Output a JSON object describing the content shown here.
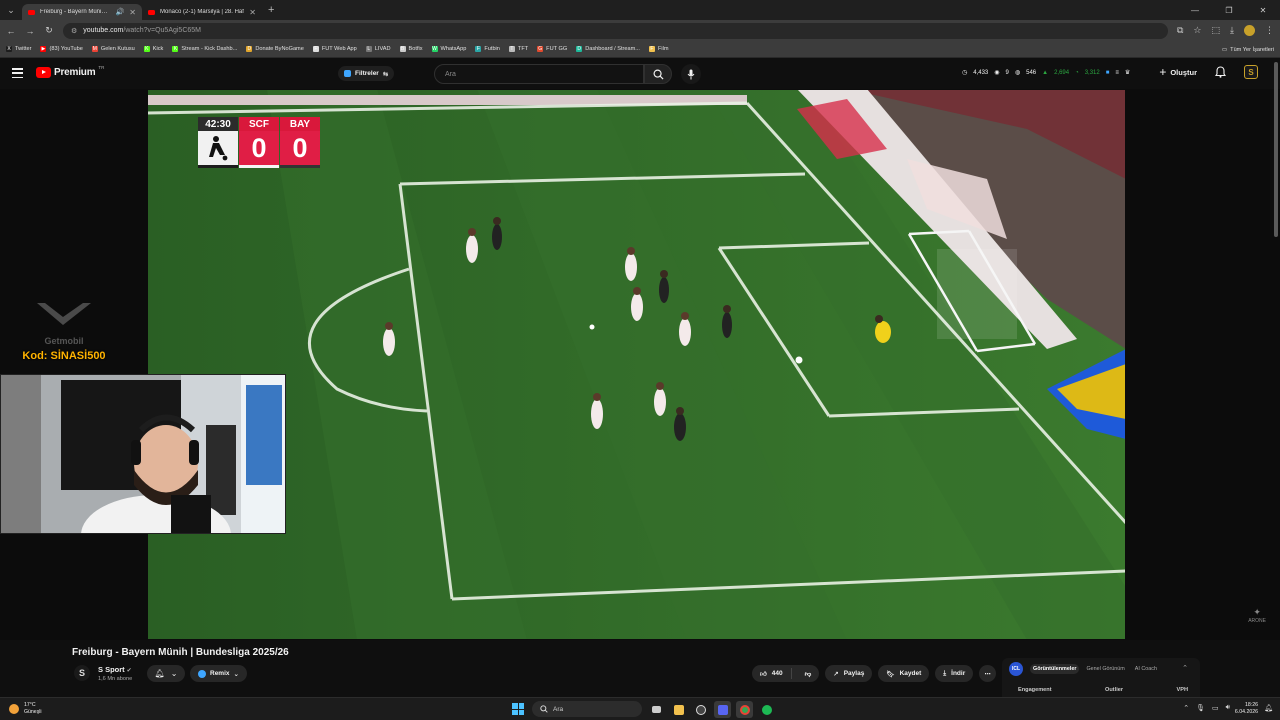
{
  "browser": {
    "tabs": [
      {
        "title": "Freiburg - Bayern Münih | B",
        "active": true
      },
      {
        "title": "Monaco (2-1) Marsilya | 28. Haf",
        "active": false
      }
    ],
    "new_tab": "+",
    "window_controls": [
      "—",
      "❐",
      "✕"
    ],
    "url_host": "youtube.com",
    "url_path": "/watch?v=Qu5Agi5C65M",
    "bookmarks": [
      {
        "label": "Twitter",
        "color": "#1d1d1d",
        "glyph": "X"
      },
      {
        "label": "(83) YouTube",
        "color": "#ff0000",
        "glyph": "▶"
      },
      {
        "label": "Gelen Kutusu",
        "color": "#ea4335",
        "glyph": "M"
      },
      {
        "label": "Kick",
        "color": "#53fc18",
        "glyph": "K"
      },
      {
        "label": "Stream - Kick Dashb...",
        "color": "#53fc18",
        "glyph": "K"
      },
      {
        "label": "Donate ByNoGame",
        "color": "#e0a52c",
        "glyph": "D"
      },
      {
        "label": "FUT Web App",
        "color": "#dddddd",
        "glyph": "F"
      },
      {
        "label": "LIVAD",
        "color": "#777777",
        "glyph": "L"
      },
      {
        "label": "Botfix",
        "color": "#cccccc",
        "glyph": "B"
      },
      {
        "label": "WhatsApp",
        "color": "#25d366",
        "glyph": "W"
      },
      {
        "label": "Futbin",
        "color": "#2aa6a6",
        "glyph": "F"
      },
      {
        "label": "TFT",
        "color": "#bbbbbb",
        "glyph": "T"
      },
      {
        "label": "FUT GG",
        "color": "#e04a2e",
        "glyph": "G"
      },
      {
        "label": "Dashboard / Stream...",
        "color": "#1db99a",
        "glyph": "D"
      },
      {
        "label": "Film",
        "color": "#f2c14e",
        "glyph": "F"
      }
    ],
    "all_bookmarks": "Tüm Yer İşaretleri"
  },
  "header": {
    "logo_word": "Premium",
    "logo_country": "TR",
    "filters_label": "Filtreler",
    "search_placeholder": "Ara",
    "stats": {
      "views": "4,433",
      "watching": "9",
      "subs": "546",
      "growth": "2,694",
      "likes": "3,312"
    },
    "create_label": "Oluştur"
  },
  "player": {
    "scoreboard": {
      "time": "42:30",
      "home": "SCF",
      "away": "BAY",
      "home_score": "0",
      "away_score": "0"
    },
    "sponsor_brand": "Getmobil",
    "sponsor_code": "Kod: SİNASİ500",
    "watermark": "ARONE"
  },
  "video": {
    "title": "Freiburg - Bayern Münih | Bundesliga 2025/26",
    "channel": "S Sport",
    "channel_initial": "S",
    "subscribers": "1,6 Mn abone",
    "remix_label": "Remix",
    "likes": "440",
    "share_label": "Paylaş",
    "save_label": "Kaydet",
    "download_label": "İndir"
  },
  "side_panel": {
    "badge": "ICL",
    "tabs": [
      "Görüntülenmeler",
      "Genel Görünüm",
      "AI Coach"
    ],
    "columns": [
      "Engagement",
      "Outlier",
      "VPH"
    ]
  },
  "taskbar": {
    "temperature": "17°C",
    "weather": "Güneşli",
    "search_placeholder": "Ara",
    "time": "18:26",
    "date": "6.04.2026"
  },
  "colors": {
    "youtube_red": "#ff0000",
    "freiburg_red": "#e01e45",
    "pitch_green": "#2f6f2a",
    "accent_blue": "#3ea6ff",
    "sponsor_yellow": "#ffb300"
  }
}
